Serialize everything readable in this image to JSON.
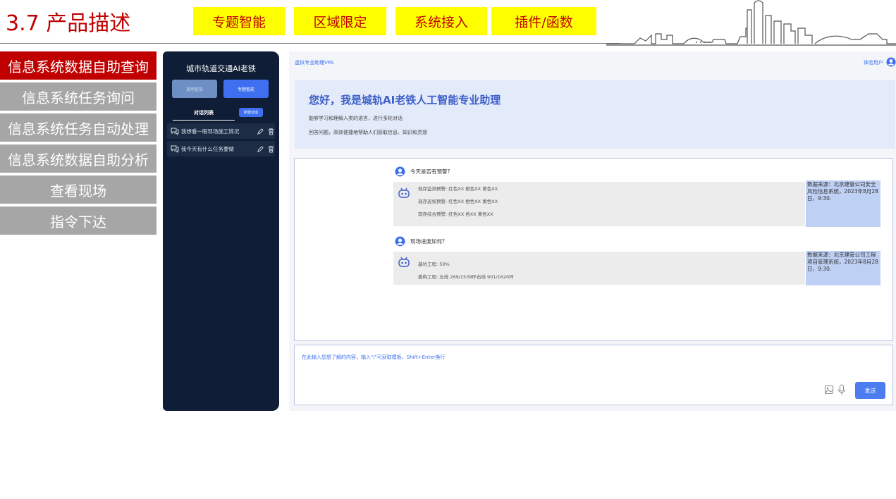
{
  "header": {
    "title": "3.7 产品描述",
    "tags": [
      "专题智能",
      "区域限定",
      "系统接入",
      "插件/函数"
    ]
  },
  "nav": {
    "items": [
      {
        "label": "信息系统数据自助查询",
        "active": true
      },
      {
        "label": "信息系统任务询问",
        "active": false
      },
      {
        "label": "信息系统任务自动处理",
        "active": false
      },
      {
        "label": "信息系统数据自助分析",
        "active": false
      },
      {
        "label": "查看现场",
        "active": false
      },
      {
        "label": "指令下达",
        "active": false
      }
    ]
  },
  "app": {
    "sidebar": {
      "title": "城市轨道交通AI老铁",
      "mode_general": "通用智能",
      "mode_topic": "专题智能",
      "list_title": "对话列表",
      "new_chat": "新建对话",
      "conversations": [
        "我想看一眼现场施工情况",
        "我今天有什么任务要做"
      ]
    },
    "top": {
      "vpa_label": "虚拟专业助理VPA",
      "user_label": "体验用户"
    },
    "welcome": {
      "title": "您好，我是城轨AI老铁人工智能专业助理",
      "line1": "能够学习和理解人类的语言，进行多轮对话",
      "line2": "回答问题，高效便捷地帮助人们获取信息、知识和灵感"
    },
    "chat": {
      "q1": "今天是否有预警?",
      "a1": [
        "现存监测预警: 红色XX 橙色XX 黄色XX",
        "现存巡视预警: 红色XX 橙色XX 黄色XX",
        "现存综合预警: 红色XX 色XX 黄色XX"
      ],
      "s1": "数据来源：北京建管公司安全风险信息系统，2023年8月28日，9:30.",
      "q2": "现场进度如何?",
      "a2": [
        "基坑工程: 50%",
        "盾构工程: 左线 269/1539环右线 901/1620环"
      ],
      "s2": "数据来源：北京建管公司工程项目管理系统，2023年8月28日，9:30."
    },
    "input": {
      "placeholder": "在此输入您想了解的内容，输入\"/\"可获取模板，Shift+Enter换行",
      "send": "发送"
    }
  },
  "colors": {
    "title_red": "#c00000",
    "tag_yellow": "#ffff00",
    "nav_active": "#c00000",
    "nav_inactive": "#a6a6a6",
    "sidebar_bg": "#0f1e36",
    "accent_blue": "#3d6ff0"
  },
  "icons": [
    "skyline-icon",
    "chat-bubble-icon",
    "edit-icon",
    "trash-icon",
    "user-avatar-icon",
    "robot-icon",
    "image-icon",
    "microphone-icon"
  ]
}
